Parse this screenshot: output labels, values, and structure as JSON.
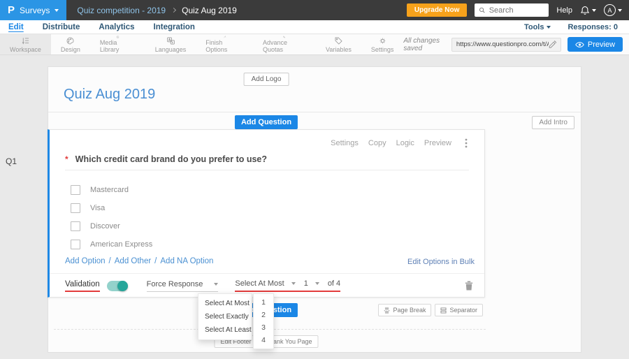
{
  "topbar": {
    "logo_letter": "P",
    "product_menu": "Surveys",
    "breadcrumb": {
      "parent": "Quiz competition - 2019",
      "current": "Quiz Aug 2019"
    },
    "upgrade_button": "Upgrade Now",
    "search_placeholder": "Search",
    "help": "Help",
    "avatar_initial": "A"
  },
  "tabbar": {
    "tabs": [
      "Edit",
      "Distribute",
      "Analytics",
      "Integration"
    ],
    "active_tab": "Edit",
    "tools": "Tools",
    "responses": "Responses: 0"
  },
  "toolbar": {
    "items": [
      "Workspace",
      "Design",
      "Media Library",
      "Languages",
      "Finish Options",
      "Advance Quotas",
      "Variables",
      "Settings"
    ],
    "active_item": "Workspace",
    "saved_status": "All changes saved",
    "share_url": "https://www.questionpro.com/t/APNrFZ",
    "preview_button": "Preview"
  },
  "survey": {
    "add_logo_button": "Add Logo",
    "title": "Quiz Aug 2019",
    "add_question_button": "Add Question",
    "add_intro_button": "Add Intro"
  },
  "question": {
    "id": "Q1",
    "required_marker": "*",
    "text": "Which credit card brand do you prefer to use?",
    "actions": [
      "Settings",
      "Copy",
      "Logic",
      "Preview"
    ],
    "options": [
      "Mastercard",
      "Visa",
      "Discover",
      "American Express"
    ],
    "add_links": {
      "add_option": "Add Option",
      "separator": "/",
      "add_other": "Add Other",
      "add_na": "Add NA Option"
    },
    "edit_bulk": "Edit Options in Bulk",
    "validation": {
      "label": "Validation",
      "toggle_on": true,
      "force_response": "Force Response",
      "select_type": "Select At Most",
      "count": "1",
      "of_total": "of 4"
    }
  },
  "footer_area": {
    "add_question_button": "Add Question",
    "page_break_button": "Page Break",
    "separator_button": "Separator",
    "edit_footer_button": "Edit Footer",
    "thank_you_button": "Thank You Page"
  },
  "dropdown_select_type": {
    "options": [
      "Select At Most",
      "Select Exactly",
      "Select At Least"
    ]
  },
  "dropdown_count": {
    "options": [
      "1",
      "2",
      "3",
      "4"
    ]
  },
  "colors": {
    "accent_blue": "#1b87e6",
    "orange": "#f7a21b",
    "teal_toggle": "#26a69a",
    "red_underline": "#e23b3b",
    "topbar_dark": "#3b3b3b"
  }
}
